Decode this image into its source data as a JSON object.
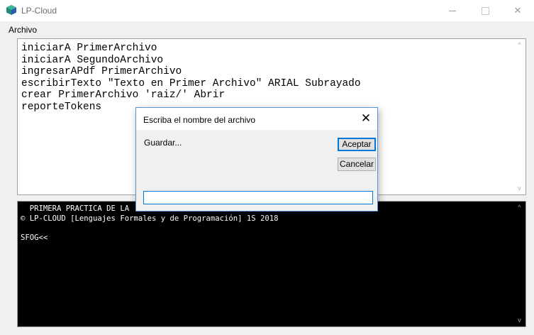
{
  "window": {
    "title": "LP-Cloud",
    "minimize_glyph": "—",
    "close_glyph": "✕"
  },
  "menu": {
    "items": [
      {
        "label": "Archivo"
      }
    ]
  },
  "editor": {
    "code": "iniciarA PrimerArchivo\niniciarA SegundoArchivo\ningresarAPdf PrimerArchivo\nescribirTexto \"Texto en Primer Archivo\" ARIAL Subrayado\ncrear PrimerArchivo 'raiz/' Abrir\nreporteTokens"
  },
  "console": {
    "text": "  PRIMERA PRACTICA DE LA\n© LP-CLOUD [Lenguajes Formales y de Programación] 1S 2018\n\nSFOG<<"
  },
  "dialog": {
    "title": "Escriba el nombre del archivo",
    "close_glyph": "✕",
    "prompt": "Guardar...",
    "ok_label": "Aceptar",
    "cancel_label": "Cancelar",
    "input_value": ""
  },
  "scroll": {
    "up_glyph": "^",
    "down_glyph": "v"
  },
  "colors": {
    "app_icon_primary": "#1f8a7a",
    "app_icon_secondary": "#2a5db0",
    "focus_accent": "#0078d7"
  }
}
